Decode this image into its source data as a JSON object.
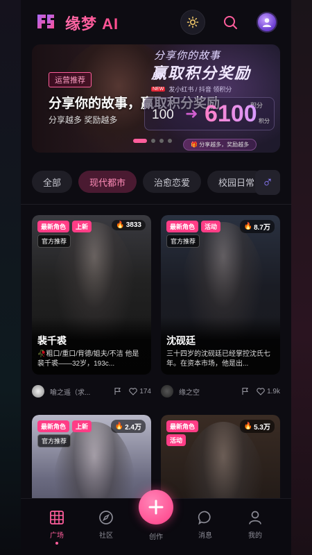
{
  "header": {
    "brand": "缘梦 AI",
    "theme_icon": "sun-icon",
    "search_icon": "search-icon",
    "avatar_icon": "user-avatar"
  },
  "banner": {
    "tag": "运营推荐",
    "title_top": "分享你的故事",
    "title_big": "赢取积分奖励",
    "platform_badge": "NEW",
    "platforms": "发小红书 / 抖音 领积分",
    "headline": "分享你的故事，赢取积分奖励",
    "subtitle": "分享越多 奖励越多",
    "points_label": "积分",
    "points_from": "100",
    "points_to": "6100",
    "points_unit": "积分",
    "cta": "分享越多，奖励越多",
    "active_slide": 1,
    "slide_count": 4
  },
  "tabs": [
    {
      "label": "全部",
      "active": false
    },
    {
      "label": "现代都市",
      "active": true
    },
    {
      "label": "治愈恋爱",
      "active": false
    },
    {
      "label": "校园日常",
      "active": false
    }
  ],
  "gender_icon": "male-icon",
  "cards": [
    {
      "badges": [
        "最新角色",
        "上新"
      ],
      "official": "官方推荐",
      "heat": "3833",
      "name": "裴千裘",
      "desc": "🥀粗口/重口/背德/姐夫/不洁 他是裴千裘——32岁，193c...",
      "author": "喻之遥（求...",
      "likes": "174"
    },
    {
      "badges": [
        "最新角色",
        "活动"
      ],
      "official": "官方推荐",
      "heat": "8.7万",
      "name": "沈砚廷",
      "desc": "三十四岁的沈砚廷已经掌控沈氏七年。在资本市场，他是出...",
      "author": "缘之空",
      "likes": "1.9k"
    },
    {
      "badges": [
        "最新角色",
        "上新"
      ],
      "official": "官方推荐",
      "heat": "2.4万",
      "name": "",
      "desc": "",
      "author": "",
      "likes": ""
    },
    {
      "badges": [
        "最新角色"
      ],
      "official": "",
      "second_row_badge": "活动",
      "heat": "5.3万",
      "name": "",
      "desc": "",
      "author": "",
      "likes": ""
    }
  ],
  "nav": {
    "items": [
      {
        "label": "广场",
        "icon": "grid-icon",
        "active": true
      },
      {
        "label": "社区",
        "icon": "compass-icon",
        "active": false
      },
      {
        "label": "创作",
        "icon": "plus-icon",
        "active": false
      },
      {
        "label": "消息",
        "icon": "chat-icon",
        "active": false
      },
      {
        "label": "我的",
        "icon": "user-icon",
        "active": false
      }
    ]
  },
  "colors": {
    "accent": "#ff5e9c",
    "background": "#0d0c12",
    "tab_active_bg": "#4a1a31"
  }
}
